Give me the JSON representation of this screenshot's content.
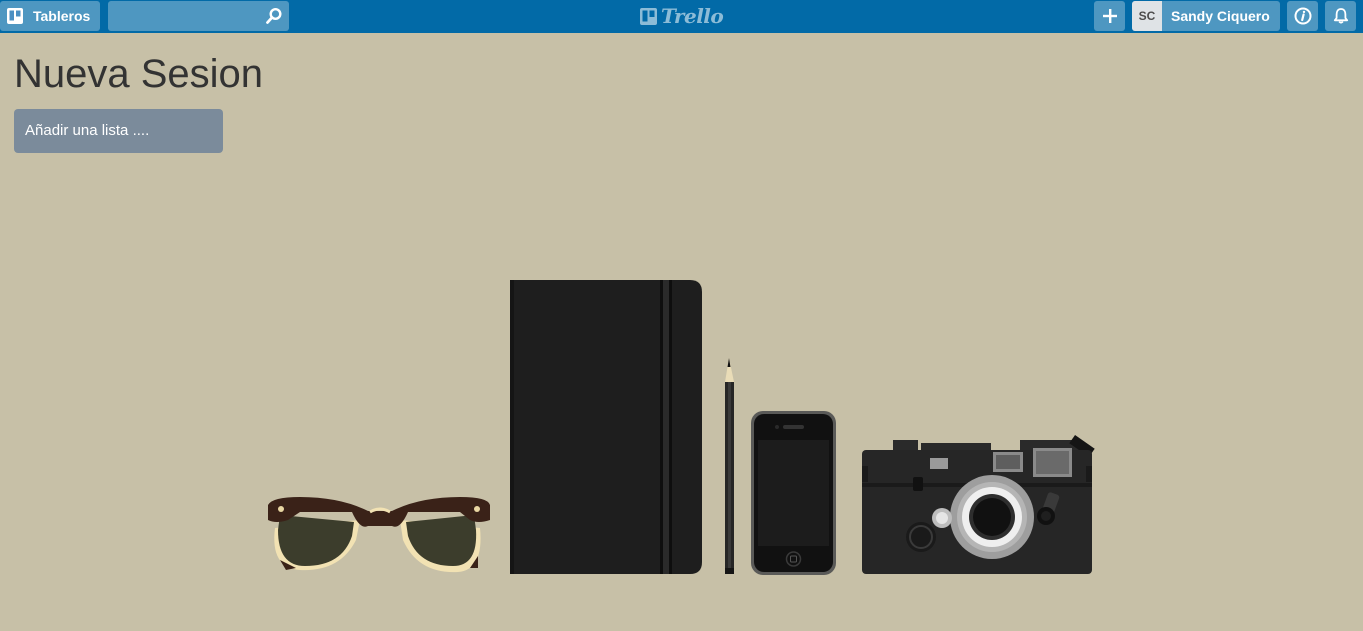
{
  "header": {
    "boards_label": "Tableros",
    "search": {
      "value": "",
      "placeholder": ""
    },
    "logo_text": "Trello",
    "member": {
      "initials": "SC",
      "name": "Sandy Ciquero"
    }
  },
  "board": {
    "title": "Nueva Sesion",
    "add_list_label": "Añadir una lista ...."
  },
  "colors": {
    "header_bg": "#026aa7",
    "board_bg": "#c7c0a7",
    "add_list_bg": "#7b8b9b"
  },
  "icons": {
    "boards": "boards-icon",
    "search": "search-icon",
    "add": "plus-icon",
    "info": "info-icon",
    "notifications": "bell-icon"
  }
}
